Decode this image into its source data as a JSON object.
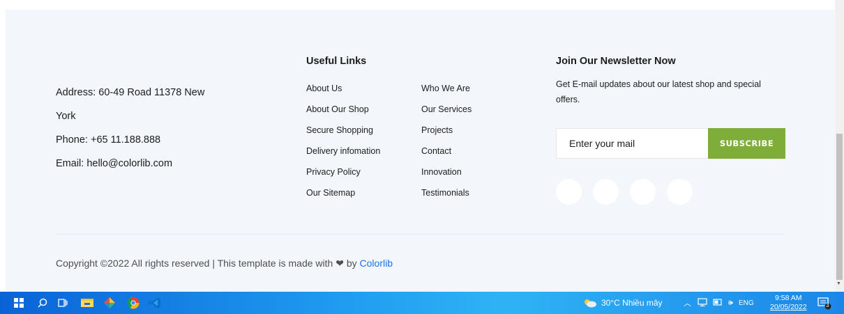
{
  "contact": {
    "address_line1": "Address: 60-49 Road 11378 New",
    "address_line2": "York",
    "phone": "Phone: +65 11.188.888",
    "email": "Email: hello@colorlib.com"
  },
  "useful_links": {
    "title": "Useful Links",
    "column1": [
      "About Us",
      "About Our Shop",
      "Secure Shopping",
      "Delivery infomation",
      "Privacy Policy",
      "Our Sitemap"
    ],
    "column2": [
      "Who We Are",
      "Our Services",
      "Projects",
      "Contact",
      "Innovation",
      "Testimonials"
    ]
  },
  "newsletter": {
    "title": "Join Our Newsletter Now",
    "description": "Get E-mail updates about our latest shop and special offers.",
    "input_placeholder": "Enter your mail",
    "button_label": "SUBSCRIBE",
    "social_icons": [
      "facebook-icon",
      "instagram-icon",
      "twitter-icon",
      "pinterest-icon"
    ]
  },
  "copyright": {
    "prefix": "Copyright ©2022 All rights reserved | This template is made with",
    "by": "by",
    "link": "Colorlib"
  },
  "colors": {
    "accent": "#7fad39",
    "link": "#1a73e8",
    "footer_bg": "#f3f6fa"
  },
  "taskbar": {
    "weather": "30°C  Nhiều mây",
    "language": "ENG",
    "time": "9:58 AM",
    "date": "20/05/2022",
    "notification_count": "3"
  }
}
